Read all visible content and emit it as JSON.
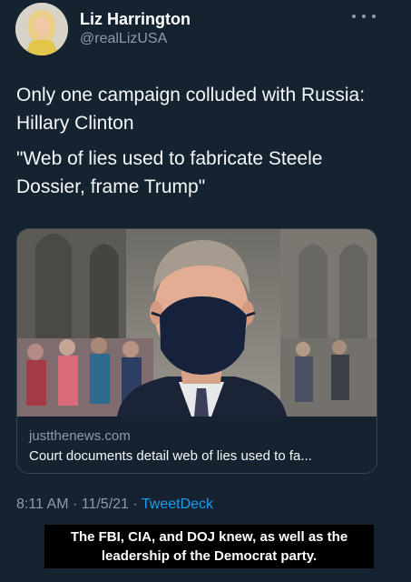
{
  "author": {
    "display_name": "Liz Harrington",
    "handle": "@realLizUSA"
  },
  "tweet": {
    "paragraphs": [
      "Only one campaign colluded with Russia: Hillary Clinton",
      "\"Web of lies used to fabricate Steele Dossier, frame Trump\""
    ]
  },
  "link_card": {
    "domain": "justthenews.com",
    "headline": "Court documents detail web of lies used to fa..."
  },
  "meta": {
    "time": "8:11 AM",
    "separator": " · ",
    "date": "11/5/21",
    "source": "TweetDeck"
  },
  "caption": {
    "line1": "The FBI, CIA, and DOJ knew, as well as the",
    "line2": "leadership of the Democrat party."
  },
  "icons": {
    "more": "more-horizontal-icon"
  },
  "colors": {
    "background": "#152230",
    "text": "#f5f8fa",
    "secondary_text": "#8f9ba6",
    "link": "#1d9bf0",
    "card_border": "#38444d"
  }
}
